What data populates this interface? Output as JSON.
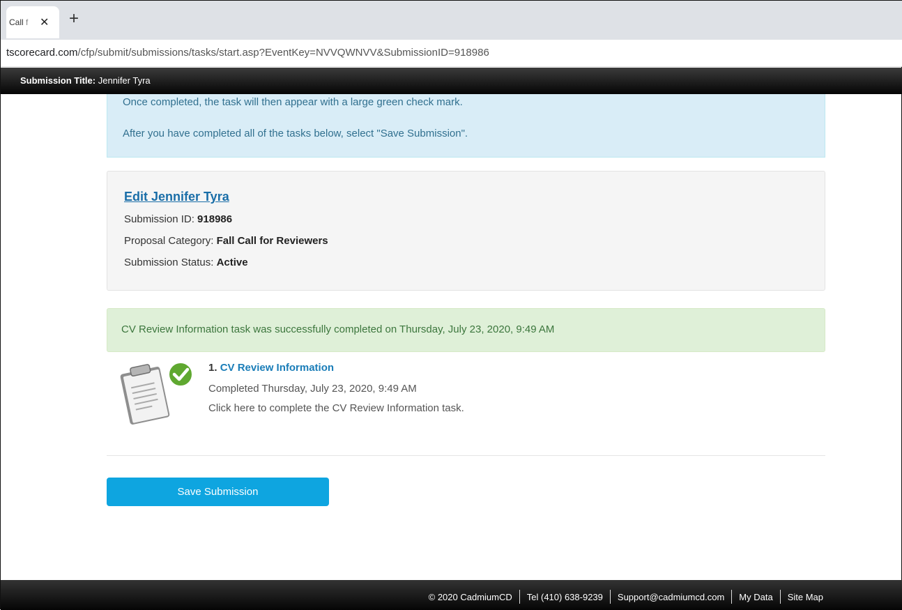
{
  "browser": {
    "tab_title": "Call f",
    "close_glyph": "✕",
    "newtab_glyph": "+",
    "url_domain": "tscorecard.com",
    "url_path": "/cfp/submit/submissions/tasks/start.asp?EventKey=NVVQWNVV&SubmissionID=918986"
  },
  "header": {
    "label": "Submission Title:",
    "value": "Jennifer Tyra"
  },
  "info_box": {
    "line1": "Once completed, the task will then appear with a large green check mark.",
    "line2": "After you have completed all of the tasks below, select \"Save Submission\"."
  },
  "submission": {
    "edit_link": "Edit Jennifer Tyra",
    "id_label": "Submission ID:",
    "id_value": "918986",
    "category_label": "Proposal Category:",
    "category_value": "Fall Call for Reviewers",
    "status_label": "Submission Status:",
    "status_value": "Active"
  },
  "alert": {
    "message": "CV Review Information task was successfully completed on Thursday, July 23, 2020, 9:49 AM"
  },
  "task": {
    "number": "1.",
    "title": "CV Review Information",
    "completed": "Completed Thursday, July 23, 2020, 9:49 AM",
    "instruction": "Click here to complete the CV Review Information task.",
    "icon": "clipboard-check-icon"
  },
  "actions": {
    "save_label": "Save Submission"
  },
  "footer": {
    "copyright": "© 2020 CadmiumCD",
    "tel": "Tel (410) 638-9239",
    "support": "Support@cadmiumcd.com",
    "my_data": "My Data",
    "site_map": "Site Map"
  },
  "colors": {
    "info_bg": "#d9edf7",
    "success_bg": "#dff0d8",
    "button": "#0ea5e0",
    "link": "#1a6ea8"
  }
}
